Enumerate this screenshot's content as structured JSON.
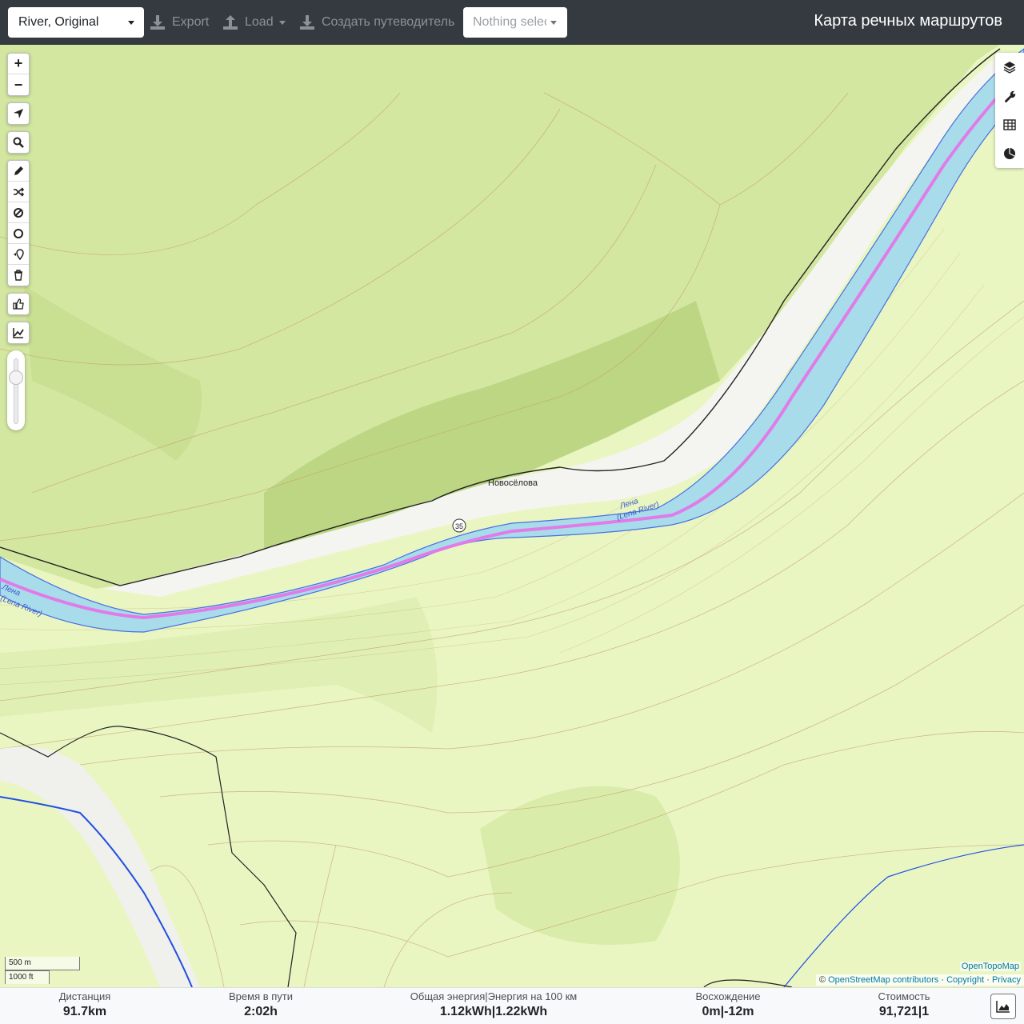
{
  "header": {
    "profile": "River, Original",
    "export_label": "Export",
    "load_label": "Load",
    "guide_label": "Создать путеводитель",
    "nothing_selected": "Nothing selected",
    "title": "Карта речных маршрутов"
  },
  "map_controls": {
    "zoom_in": "+",
    "zoom_out": "−",
    "icons": [
      "locate-icon",
      "search-icon",
      "pencil-icon",
      "shuffle-icon",
      "no-go-icon",
      "circle-icon",
      "pin-icon",
      "trash-icon",
      "thumbs-up-icon",
      "elevation-chart-icon"
    ],
    "right_icons": [
      "layers-icon",
      "wrench-icon",
      "table-icon",
      "pie-chart-icon"
    ]
  },
  "map_labels": {
    "village": "Новосёлова",
    "river_ru": "Лена",
    "river_en": "(Lena River)",
    "river_ru_left": "Лена",
    "river_en_left": "(Lena River)",
    "road_marker": "35"
  },
  "scale": {
    "metric": "500 m",
    "imperial": "1000 ft"
  },
  "attribution": {
    "provider": "OpenTopoMap",
    "prefix": "©",
    "osm": "OpenStreetMap contributors",
    "sep1": "·",
    "copyright": "Copyright",
    "sep2": "·",
    "privacy": "Privacy"
  },
  "stats": {
    "distance": {
      "label": "Дистанция",
      "value": "91.7",
      "unit": "km"
    },
    "time": {
      "label": "Время в пути",
      "value": "2:02",
      "unit": "h"
    },
    "energy": {
      "label": "Общая энергия|Энергия на 100 км",
      "value1": "1.12",
      "unit1": "kWh",
      "sep": "|",
      "value2": "1.22",
      "unit2": "kWh"
    },
    "ascent": {
      "label": "Восхождение",
      "value1": "0",
      "unit1": "m",
      "sep": "|",
      "value2": "-12",
      "unit2": "m"
    },
    "cost": {
      "label": "Стоимость",
      "value": "91,721",
      "sep": "|",
      "value2": "1"
    }
  },
  "colors": {
    "topbar": "#343a40",
    "land": "#e8f5c0",
    "river": "#a8dcea",
    "route": "#e07be8",
    "contour": "#c8a070"
  }
}
